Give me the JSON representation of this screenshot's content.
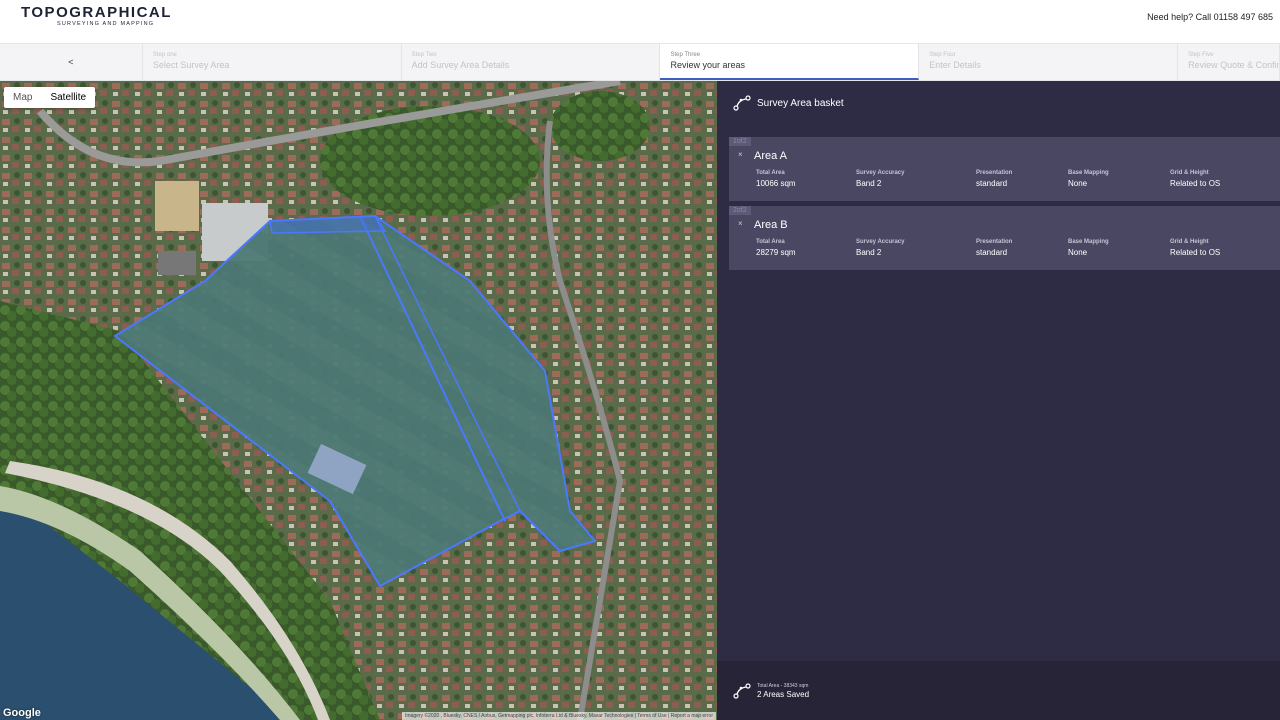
{
  "header": {
    "logo_main": "TOPOGRAPHICAL",
    "logo_sub": "SURVEYING AND MAPPING",
    "help_text": "Need help? Call 01158 497 685"
  },
  "steps": {
    "back_label": "<",
    "items": [
      {
        "number": "Step one",
        "title": "Select Survey Area"
      },
      {
        "number": "Step Two",
        "title": "Add Survey Area Details"
      },
      {
        "number": "Step Three",
        "title": "Review your areas"
      },
      {
        "number": "Step Four",
        "title": "Enter Details"
      },
      {
        "number": "Step Five",
        "title": "Review Quote & Confirm"
      }
    ]
  },
  "map": {
    "type_map": "Map",
    "type_satellite": "Satellite",
    "google_label": "Google",
    "attribution": "Imagery ©2020 , Bluesky, CNES / Airbus, Getmapping plc, Infoterra Ltd & Bluesky, Maxar Technologies | Terms of Use | Report a map error"
  },
  "basket": {
    "title": "Survey Area basket",
    "areas": [
      {
        "index": "1of2",
        "close": "×",
        "name": "Area A",
        "total_area_label": "Total Area",
        "total_area": "10066 sqm",
        "accuracy_label": "Survey Accuracy",
        "accuracy": "Band 2",
        "presentation_label": "Presentation",
        "presentation": "standard",
        "base_mapping_label": "Base Mapping",
        "base_mapping": "None",
        "grid_label": "Grid & Height",
        "grid": "Related to OS"
      },
      {
        "index": "2of2",
        "close": "×",
        "name": "Area B",
        "total_area_label": "Total Area",
        "total_area": "28279 sqm",
        "accuracy_label": "Survey Accuracy",
        "accuracy": "Band 2",
        "presentation_label": "Presentation",
        "presentation": "standard",
        "base_mapping_label": "Base Mapping",
        "base_mapping": "None",
        "grid_label": "Grid & Height",
        "grid": "Related to OS"
      }
    ],
    "footer_total": "Total Area - 38343 sqm",
    "footer_saved": "2 Areas Saved"
  },
  "colors": {
    "panel_bg": "#2e2b45",
    "card_bg": "#4a4762",
    "polygon_stroke": "#4a78ff",
    "active_step_border": "#3e5fbf"
  }
}
